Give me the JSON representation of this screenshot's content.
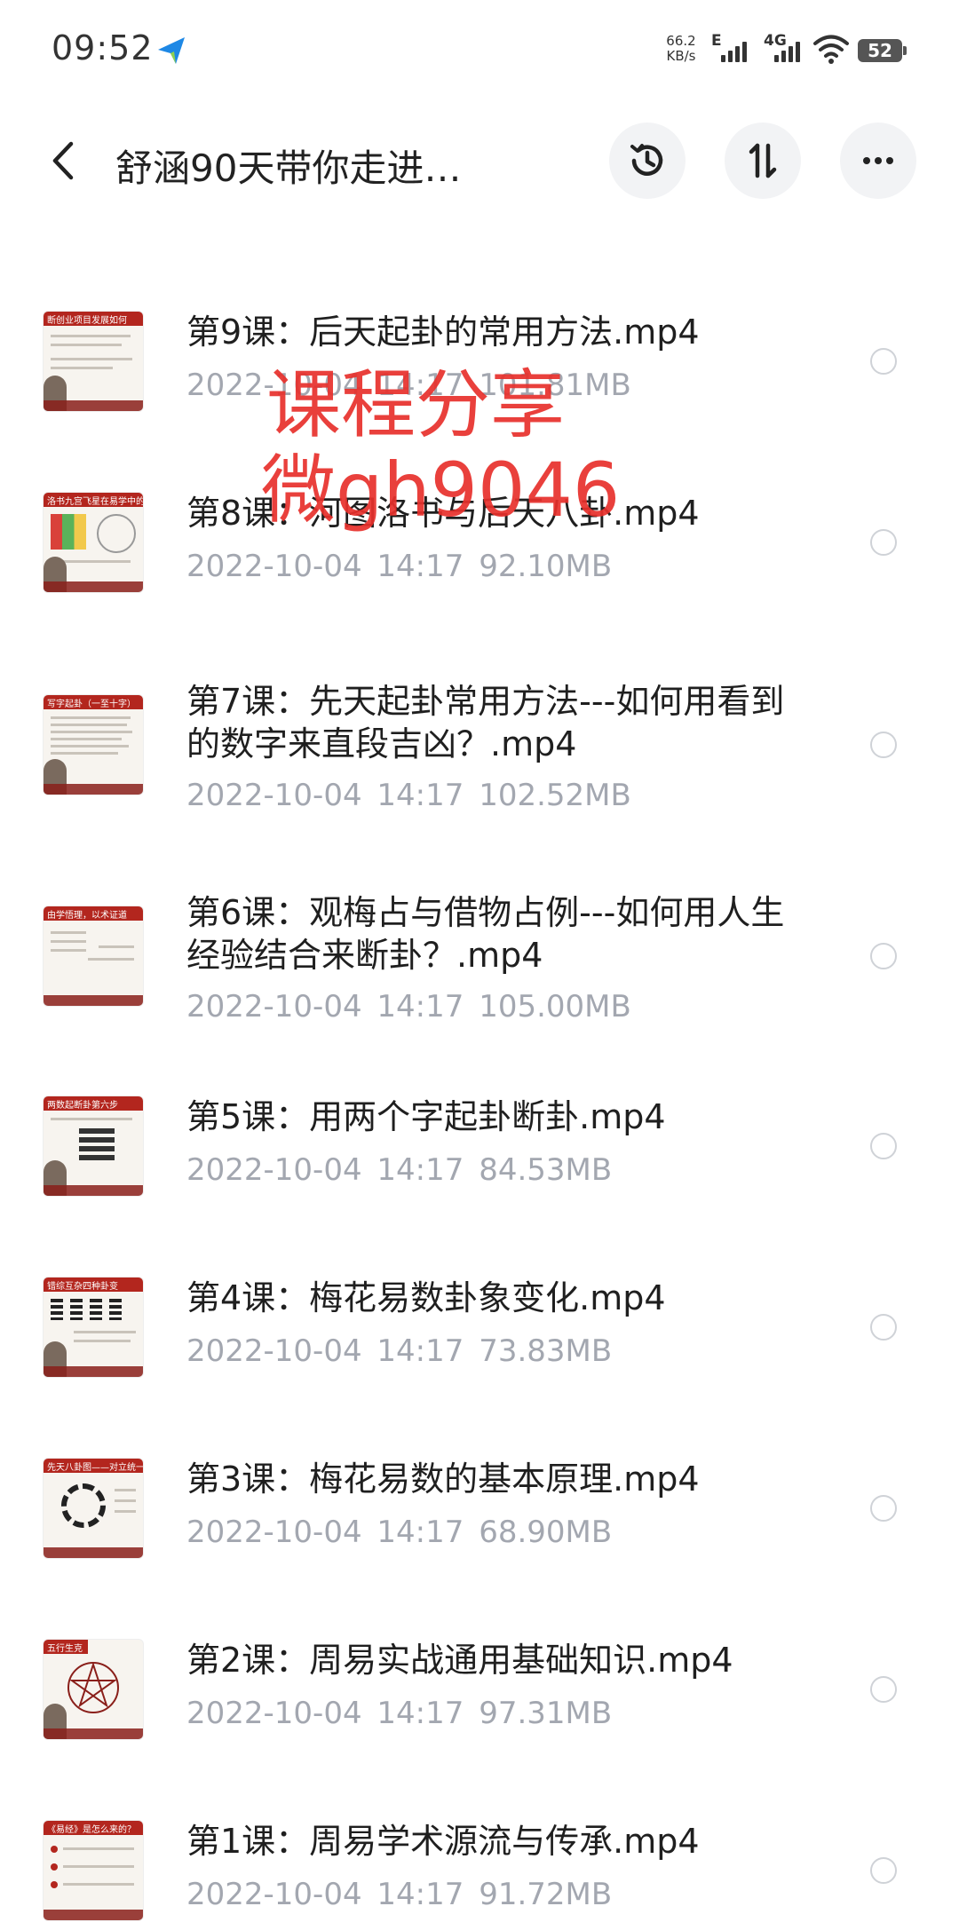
{
  "status_bar": {
    "time": "09:52",
    "net_speed_value": "66.2",
    "net_speed_unit": "KB/s",
    "network_e": "E",
    "network_4g": "4G",
    "battery": "52"
  },
  "header": {
    "title": "舒涵90天带你走进…",
    "back_icon": "back-arrow-icon",
    "history_icon": "history-icon",
    "sort_icon": "sort-icon",
    "more_icon": "more-icon"
  },
  "watermark": {
    "line1": "课程分享",
    "line2": "微gh9046"
  },
  "files": [
    {
      "name": "第9课：后天起卦的常用方法.mp4",
      "date": "2022-10-04",
      "time": "14:17",
      "size": "101.81MB",
      "thumb_title": "断创业项目发展如何"
    },
    {
      "name": "第8课：河图洛书与后天八卦.mp4",
      "date": "2022-10-04",
      "time": "14:17",
      "size": "92.10MB",
      "thumb_title": "洛书九宫飞星在易学中的"
    },
    {
      "name": "第7课：先天起卦常用方法---如何用看到的数字来直段吉凶？.mp4",
      "date": "2022-10-04",
      "time": "14:17",
      "size": "102.52MB",
      "thumb_title": "写字起卦（一至十字）"
    },
    {
      "name": "第6课：观梅占与借物占例---如何用人生经验结合来断卦？.mp4",
      "date": "2022-10-04",
      "time": "14:17",
      "size": "105.00MB",
      "thumb_title": "由学悟理，以术证道"
    },
    {
      "name": "第5课：用两个字起卦断卦.mp4",
      "date": "2022-10-04",
      "time": "14:17",
      "size": "84.53MB",
      "thumb_title": "两数起断卦第六步"
    },
    {
      "name": "第4课：梅花易数卦象变化.mp4",
      "date": "2022-10-04",
      "time": "14:17",
      "size": "73.83MB",
      "thumb_title": "错综互杂四种卦变"
    },
    {
      "name": "第3课：梅花易数的基本原理.mp4",
      "date": "2022-10-04",
      "time": "14:17",
      "size": "68.90MB",
      "thumb_title": "先天八卦图——对立统一"
    },
    {
      "name": "第2课：周易实战通用基础知识.mp4",
      "date": "2022-10-04",
      "time": "14:17",
      "size": "97.31MB",
      "thumb_title": "五行生克"
    },
    {
      "name": "第1课：周易学术源流与传承.mp4",
      "date": "2022-10-04",
      "time": "14:17",
      "size": "91.72MB",
      "thumb_title": "《易经》是怎么来的？"
    }
  ]
}
